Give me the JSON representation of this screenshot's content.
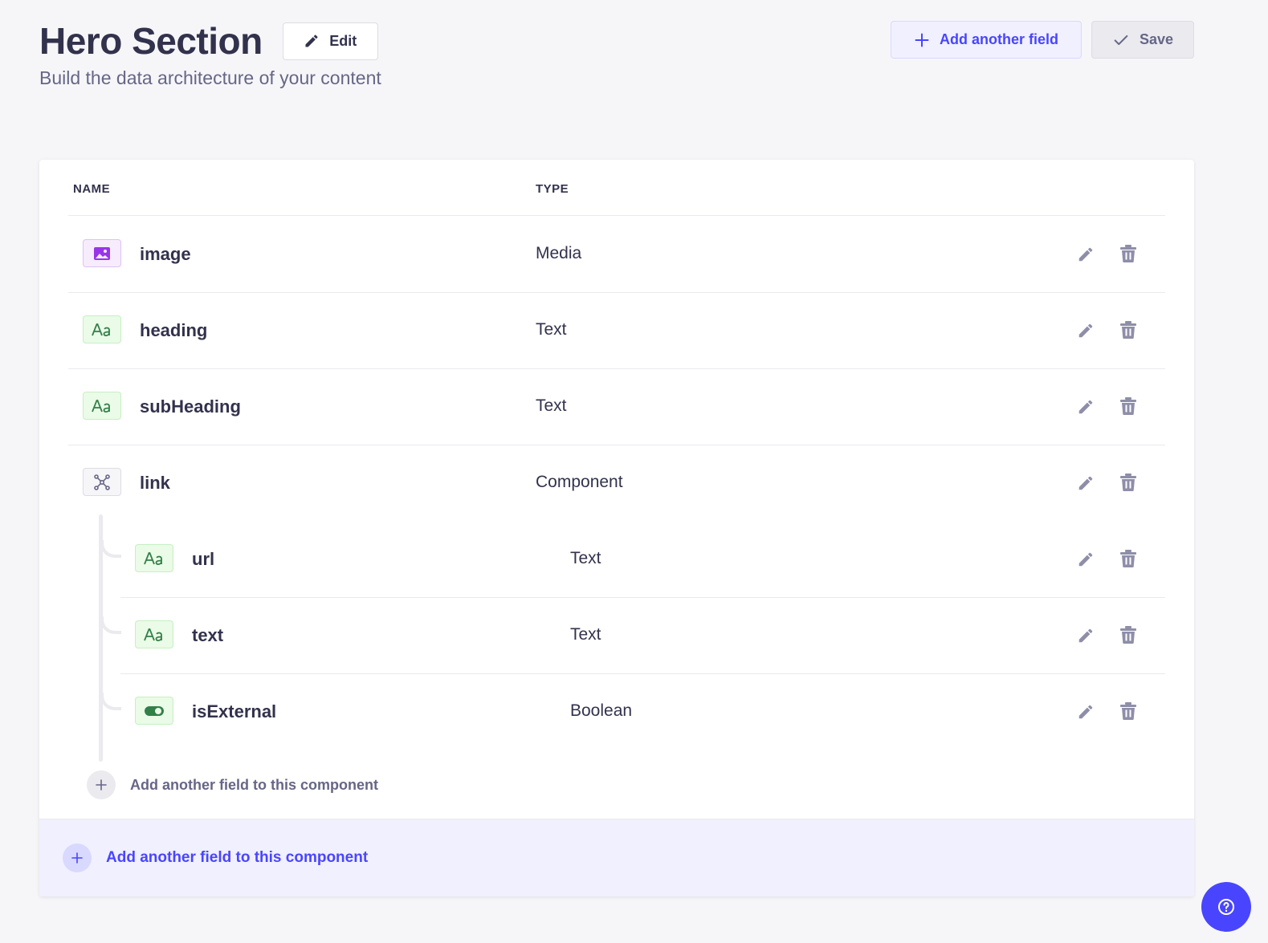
{
  "header": {
    "title": "Hero Section",
    "subtitle": "Build the data architecture of your content",
    "edit_label": "Edit",
    "add_field_label": "Add another field",
    "save_label": "Save"
  },
  "table": {
    "col_name": "NAME",
    "col_type": "TYPE",
    "rows": [
      {
        "name": "image",
        "type": "Media",
        "icon": "media-icon"
      },
      {
        "name": "heading",
        "type": "Text",
        "icon": "text-icon"
      },
      {
        "name": "subHeading",
        "type": "Text",
        "icon": "text-icon"
      },
      {
        "name": "link",
        "type": "Component",
        "icon": "component-icon"
      }
    ],
    "subrows": [
      {
        "name": "url",
        "type": "Text",
        "icon": "text-icon"
      },
      {
        "name": "text",
        "type": "Text",
        "icon": "text-icon"
      },
      {
        "name": "isExternal",
        "type": "Boolean",
        "icon": "boolean-icon"
      }
    ],
    "inner_add_label": "Add another field to this component",
    "footer_add_label": "Add another field to this component"
  },
  "colors": {
    "primary": "#4945ff",
    "text": "#32324d",
    "muted": "#666687",
    "media": "#9736e8",
    "text_icon": "#328048"
  }
}
